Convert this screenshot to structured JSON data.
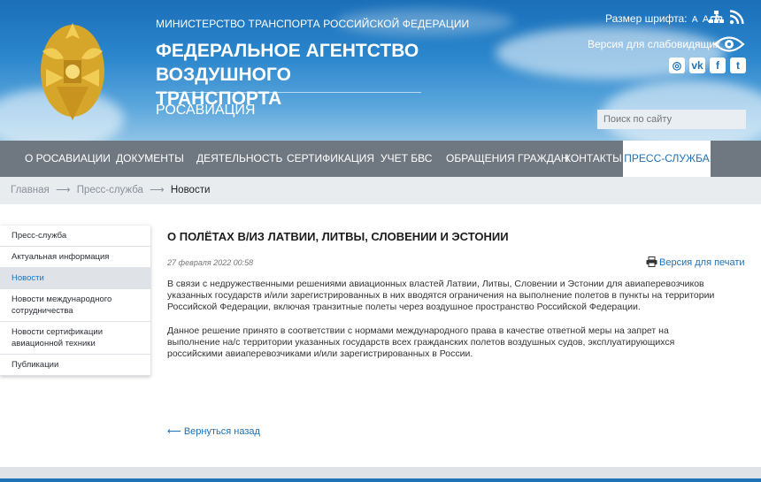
{
  "header": {
    "ministry": "МИНИСТЕРСТВО ТРАНСПОРТА РОССИЙСКОЙ ФЕДЕРАЦИИ",
    "agency_line1": "ФЕДЕРАЛЬНОЕ АГЕНТСТВО",
    "agency_line2": "ВОЗДУШНОГО ТРАНСПОРТА",
    "short_name": "РОСАВИАЦИЯ",
    "font_size_label": "Размер шрифта:",
    "font_sizes": [
      "A",
      "A",
      "A"
    ],
    "low_vision_label": "Версия для слабовидящих",
    "social": [
      {
        "icon": "instagram-icon",
        "glyph": "◎"
      },
      {
        "icon": "vk-icon",
        "glyph": "vk"
      },
      {
        "icon": "facebook-icon",
        "glyph": "f"
      },
      {
        "icon": "twitter-icon",
        "glyph": "t"
      }
    ],
    "search_placeholder": "Поиск по сайту"
  },
  "nav": {
    "items": [
      {
        "label": "О Росавиации"
      },
      {
        "label": "Документы"
      },
      {
        "label": "Деятельность"
      },
      {
        "label": "Сертификация"
      },
      {
        "label": "Учет БВС"
      },
      {
        "label": "Обращения граждан"
      },
      {
        "label": "Контакты"
      },
      {
        "label": "Пресс-служба",
        "active": true
      }
    ]
  },
  "breadcrumb": {
    "items": [
      "Главная",
      "Пресс-служба",
      "Новости"
    ]
  },
  "sidebar": {
    "items": [
      {
        "label": "Пресс-служба"
      },
      {
        "label": "Актуальная информация"
      },
      {
        "label": "Новости",
        "active": true
      },
      {
        "label": "Новости международного сотрудничества"
      },
      {
        "label": "Новости сертификации авиационной техники"
      },
      {
        "label": "Публикации"
      }
    ]
  },
  "article": {
    "title": "О полётах в/из Латвии, Литвы, Словении и Эстонии",
    "date": "27 февраля 2022 00:58",
    "print_label": "Версия для печати",
    "paragraph1": "В связи с недружественными  решениями авиационных властей Латвии, Литвы,  Словении и Эстонии для авиаперевозчиков указанных государств и/или зарегистрированных в них вводятся ограничения на выполнение полетов в пункты на территории Российской Федерации, включая транзитные полеты через воздушное пространство Российской Федерации.",
    "paragraph2": "Данное решение принято в соответствии с нормами международного права в качестве ответной меры на запрет на выполнение на/с территории указанных государств всех гражданских полетов воздушных судов, эксплуатирующихся российскими авиаперевозчиками и/или зарегистрированных в России.",
    "back_label": "Вернуться назад"
  },
  "colors": {
    "accent": "#1e72b6",
    "nav_bg": "#6f7780"
  }
}
